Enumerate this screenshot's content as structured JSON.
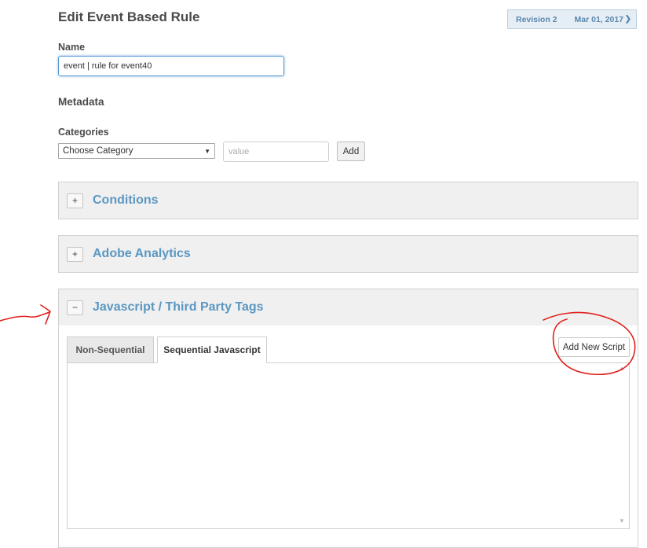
{
  "header": {
    "title": "Edit Event Based Rule",
    "revision_label": "Revision 2",
    "revision_date": "Mar 01, 2017"
  },
  "form": {
    "name_label": "Name",
    "name_value": "event | rule for event40",
    "metadata_heading": "Metadata",
    "categories_label": "Categories",
    "category_select": "Choose Category",
    "value_placeholder": "value",
    "add_button": "Add"
  },
  "panels": [
    {
      "toggle": "+",
      "title": "Conditions",
      "expanded": false
    },
    {
      "toggle": "+",
      "title": "Adobe Analytics",
      "expanded": false
    },
    {
      "toggle": "−",
      "title": "Javascript / Third Party Tags",
      "expanded": true
    }
  ],
  "script_panel": {
    "tabs": [
      {
        "label": "Non-Sequential",
        "active": false
      },
      {
        "label": "Sequential Javascript",
        "active": true
      }
    ],
    "add_script_button": "Add New Script"
  },
  "icons": {
    "revision_toggle": "chevron-down-icon",
    "select_arrow": "caret-down-icon",
    "scroll_up": "scroll-up-arrow-icon",
    "scroll_down": "scroll-down-arrow-icon"
  },
  "colors": {
    "accent": "#5b97c2",
    "annotation": "#e0201c"
  }
}
